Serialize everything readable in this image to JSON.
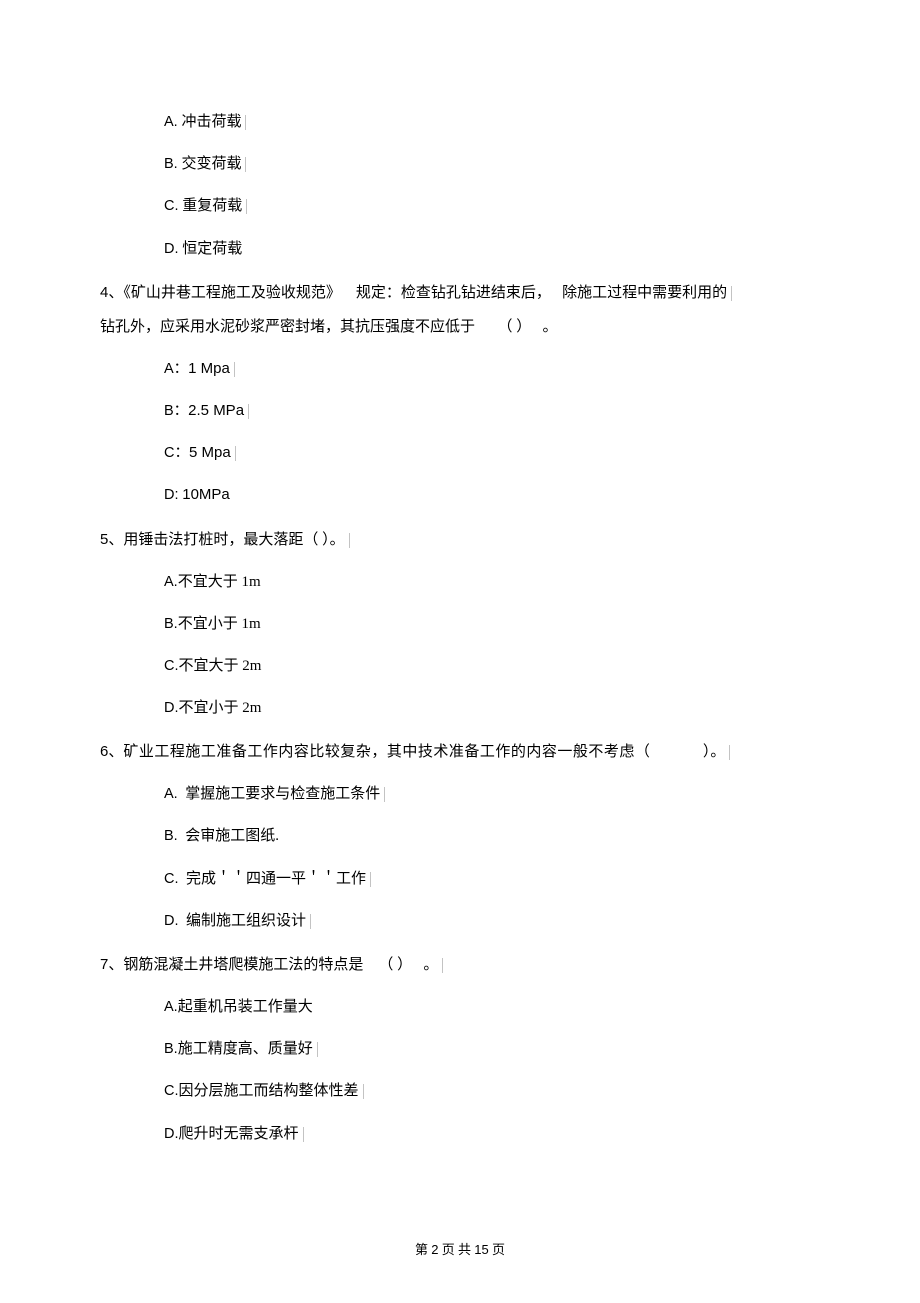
{
  "q3": {
    "options": [
      {
        "letter": "A.",
        "text": "冲击荷载"
      },
      {
        "letter": "B.",
        "text": "交变荷载"
      },
      {
        "letter": "C.",
        "text": "重复荷载"
      },
      {
        "letter": "D.",
        "text": "恒定荷载"
      }
    ]
  },
  "q4": {
    "num": "4",
    "stem_a": "、《矿山井巷工程施工及验收规范》",
    "stem_b": "规定：检查钻孔钻进结束后，",
    "stem_c": "除施工过程中需要利用的",
    "stem_line2_a": "钻孔外，应采用水泥砂浆严密封堵，其抗压强度不应低于",
    "stem_line2_b": "（    ）",
    "stem_line2_c": "。",
    "options": [
      {
        "letter": "A：",
        "text": "1 Mpa"
      },
      {
        "letter": "B：",
        "text": "2.5 MPa"
      },
      {
        "letter": "C：",
        "text": "5 Mpa"
      },
      {
        "letter": "D:",
        "text": "10MPa"
      }
    ]
  },
  "q5": {
    "num": "5",
    "stem": "、用锤击法打桩时，最大落距（          ）。",
    "options": [
      {
        "letter": "A.",
        "text": "不宜大于  1m"
      },
      {
        "letter": "B.",
        "text": "不宜小于  1m"
      },
      {
        "letter": "C.",
        "text": "不宜大于  2m"
      },
      {
        "letter": "D.",
        "text": "不宜小于  2m"
      }
    ]
  },
  "q6": {
    "num": "6",
    "stem_a": "、",
    "stem_b": "矿业工程施工准备工作内容比较复杂，其中技术准备工作的内容一般不考虑（",
    "stem_c": "）。",
    "options": [
      {
        "letter": "A.",
        "text": "掌握施工要求与检查施工条件"
      },
      {
        "letter": "B.",
        "text": "会审施工图纸."
      },
      {
        "letter": "C.",
        "text": "完成＇＇四通一平＇＇工作"
      },
      {
        "letter": "D.",
        "text": "编制施工组织设计"
      }
    ]
  },
  "q7": {
    "num": "7",
    "stem_a": "、钢筋混凝土井塔爬模施工法的特点是",
    "stem_b": "（   ）",
    "stem_c": "。",
    "options": [
      {
        "letter": "A.",
        "text": "起重机吊装工作量大"
      },
      {
        "letter": "B.",
        "text": "施工精度高、质量好"
      },
      {
        "letter": "C.",
        "text": "因分层施工而结构整体性差"
      },
      {
        "letter": "D.",
        "text": "爬升时无需支承杆"
      }
    ]
  },
  "footer": {
    "a": "第 ",
    "page": "2",
    "b": " 页 共 ",
    "total": "15",
    "c": " 页"
  }
}
